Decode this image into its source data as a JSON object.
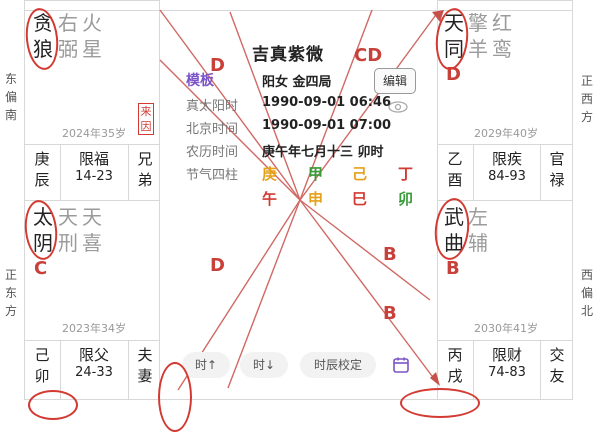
{
  "top_cut": {
    "a": "",
    "b": ""
  },
  "palaces": {
    "tl": {
      "stars_main": [
        "贪",
        "狼"
      ],
      "stars_minor": [
        "右",
        "弼"
      ],
      "stars_minor2": [
        "火",
        "星"
      ],
      "age": "2024年35岁",
      "tag": "来因",
      "limit_left": [
        "庚",
        "辰"
      ],
      "limit_mid": [
        "限福",
        "14-23"
      ],
      "limit_right": [
        "兄",
        "弟"
      ]
    },
    "tr": {
      "stars_main": [
        "天",
        "同"
      ],
      "stars_minor": [
        "擎",
        "羊"
      ],
      "stars_minor2": [
        "红",
        "鸾"
      ],
      "sihua": "D",
      "age": "2029年40岁",
      "limit_left": [
        "乙",
        "酉"
      ],
      "limit_mid": [
        "限疾",
        "84-93"
      ],
      "limit_right": [
        "官",
        "禄"
      ]
    },
    "ml": {
      "stars_main": [
        "太",
        "阴"
      ],
      "stars_minor": [
        "天",
        "刑"
      ],
      "stars_minor2": [
        "天",
        "喜"
      ],
      "sihua": "C",
      "age": "2023年34岁",
      "limit_left": [
        "己",
        "卯"
      ],
      "limit_mid": [
        "限父",
        "24-33"
      ],
      "limit_right": [
        "夫",
        "妻"
      ]
    },
    "mr": {
      "stars_main": [
        "武",
        "曲"
      ],
      "stars_minor": [
        "左",
        "辅"
      ],
      "sihua": "B",
      "age": "2030年41岁",
      "limit_left": [
        "丙",
        "戌"
      ],
      "limit_mid": [
        "限财",
        "74-83"
      ],
      "limit_right": [
        "交",
        "友"
      ]
    }
  },
  "directions": {
    "left_top": "东偏南",
    "left_bottom": "正东方",
    "right_top": "正西方",
    "right_bottom": "西偏北"
  },
  "center": {
    "title": "吉真紫微",
    "mode_badge": "模板",
    "gender_ju": "阳女 金四局",
    "edit_label": "编辑",
    "rows": [
      {
        "label": "真太阳时",
        "value": "1990-09-01 06:46"
      },
      {
        "label": "北京时间",
        "value": "1990-09-01 07:00"
      },
      {
        "label": "农历时间",
        "value": "庚午年七月十三 卯时"
      },
      {
        "label": "节气四柱",
        "value": ""
      }
    ],
    "pillars_top": [
      "庚",
      "甲",
      "己",
      "丁"
    ],
    "pillars_bottom": [
      "午",
      "申",
      "巳",
      "卯"
    ],
    "pillar_colors": [
      "#e6a11c",
      "#3a9a3a",
      "#e6a11c",
      "#d23a32"
    ],
    "pillar_colors_bottom": [
      "#d23a32",
      "#e6a11c",
      "#d23a32",
      "#3a9a3a"
    ],
    "annotations": {
      "cd": "CD",
      "d1": "D",
      "d2": "D",
      "b1": "B",
      "b2": "B"
    },
    "buttons": {
      "prev_hour": "时↑",
      "next_hour": "时↓",
      "calibrate": "时辰校定"
    }
  },
  "colors": {
    "accent_red": "#d23a32",
    "gold": "#e6a11c",
    "green": "#3a9a3a",
    "purple": "#7b55c7"
  }
}
